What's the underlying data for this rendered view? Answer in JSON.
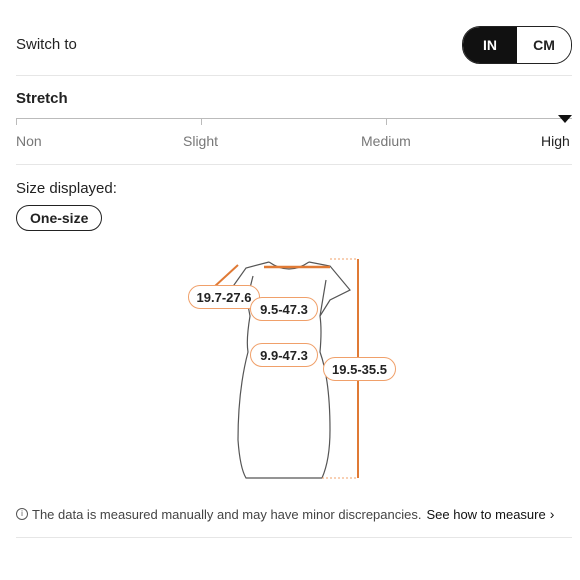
{
  "switch": {
    "label": "Switch to",
    "options": [
      "IN",
      "CM"
    ],
    "selected": "IN"
  },
  "stretch": {
    "title": "Stretch",
    "levels": [
      "Non",
      "Slight",
      "Medium",
      "High"
    ],
    "selected": "High"
  },
  "size": {
    "label": "Size displayed:",
    "value": "One-size"
  },
  "measurements": {
    "shoulder": "19.7-27.6",
    "bust": "9.5-47.3",
    "waist": "9.9-47.3",
    "length": "19.5-35.5"
  },
  "colors": {
    "accent": "#f0a06a",
    "line": "#e07a35"
  },
  "footer": {
    "note": "The data is measured manually and may have minor discrepancies.",
    "link": "See how to measure"
  }
}
